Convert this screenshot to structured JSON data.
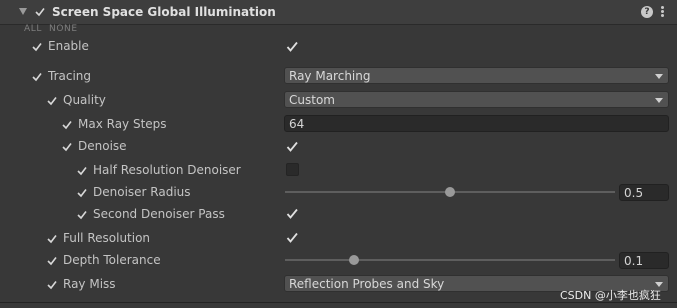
{
  "header": {
    "title": "Screen Space Global Illumination",
    "help_glyph": "?",
    "enabled": true
  },
  "toggle_all": {
    "all_label": "ALL",
    "none_label": "NONE"
  },
  "rows": {
    "enable": {
      "label": "Enable",
      "overridden": true,
      "value": true
    },
    "tracing": {
      "label": "Tracing",
      "overridden": true,
      "value": "Ray Marching"
    },
    "quality": {
      "label": "Quality",
      "overridden": true,
      "value": "Custom"
    },
    "max_ray_steps": {
      "label": "Max Ray Steps",
      "overridden": true,
      "value": "64"
    },
    "denoise": {
      "label": "Denoise",
      "overridden": true,
      "value": true
    },
    "half_res_denoiser": {
      "label": "Half Resolution Denoiser",
      "overridden": true,
      "value": false
    },
    "denoiser_radius": {
      "label": "Denoiser Radius",
      "overridden": true,
      "value": "0.5",
      "slider_fraction": 0.5
    },
    "second_denoiser_pass": {
      "label": "Second Denoiser Pass",
      "overridden": true,
      "value": true
    },
    "full_resolution": {
      "label": "Full Resolution",
      "overridden": true,
      "value": true
    },
    "depth_tolerance": {
      "label": "Depth Tolerance",
      "overridden": true,
      "value": "0.1",
      "slider_fraction": 0.2
    },
    "ray_miss": {
      "label": "Ray Miss",
      "overridden": true,
      "value": "Reflection Probes and Sky"
    }
  },
  "watermark": "CSDN @小李也疯狂",
  "colors": {
    "background": "#383838",
    "header": "#3e3e3e",
    "text": "#c4c4c4",
    "check": "#d8d8d8"
  }
}
